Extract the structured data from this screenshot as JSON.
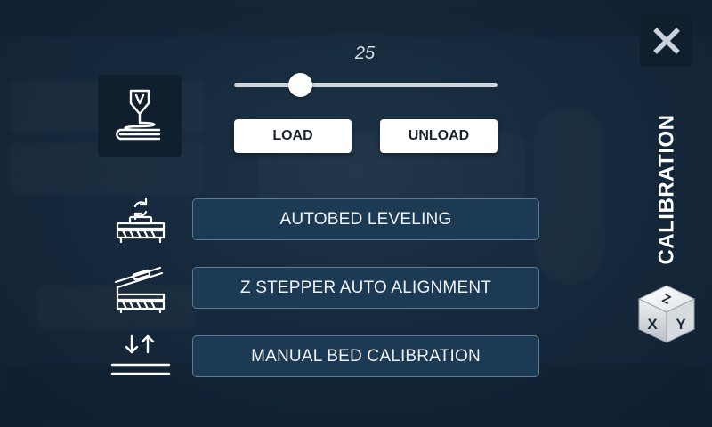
{
  "page": {
    "title": "CALIBRATION"
  },
  "filament": {
    "slider_value": "25",
    "slider_min": 0,
    "slider_max": 100,
    "slider_level": 25,
    "load_label": "LOAD",
    "unload_label": "UNLOAD",
    "icon": "extruder-filament-icon"
  },
  "actions": [
    {
      "label": "AUTOBED LEVELING",
      "icon": "autobed-leveling-icon"
    },
    {
      "label": "Z STEPPER AUTO ALIGNMENT",
      "icon": "z-stepper-alignment-icon"
    },
    {
      "label": "MANUAL BED CALIBRATION",
      "icon": "manual-bed-calibration-icon"
    }
  ],
  "close": {
    "icon": "close-icon"
  },
  "cube": {
    "letters": [
      "Z",
      "X",
      "Y"
    ],
    "icon": "xyz-cube-icon"
  },
  "colors": {
    "background": "#17293b",
    "panel": "#0f1f2e",
    "button_fill": "#1c3a53",
    "button_border": "#5f7b93",
    "accent_white": "#ffffff"
  }
}
